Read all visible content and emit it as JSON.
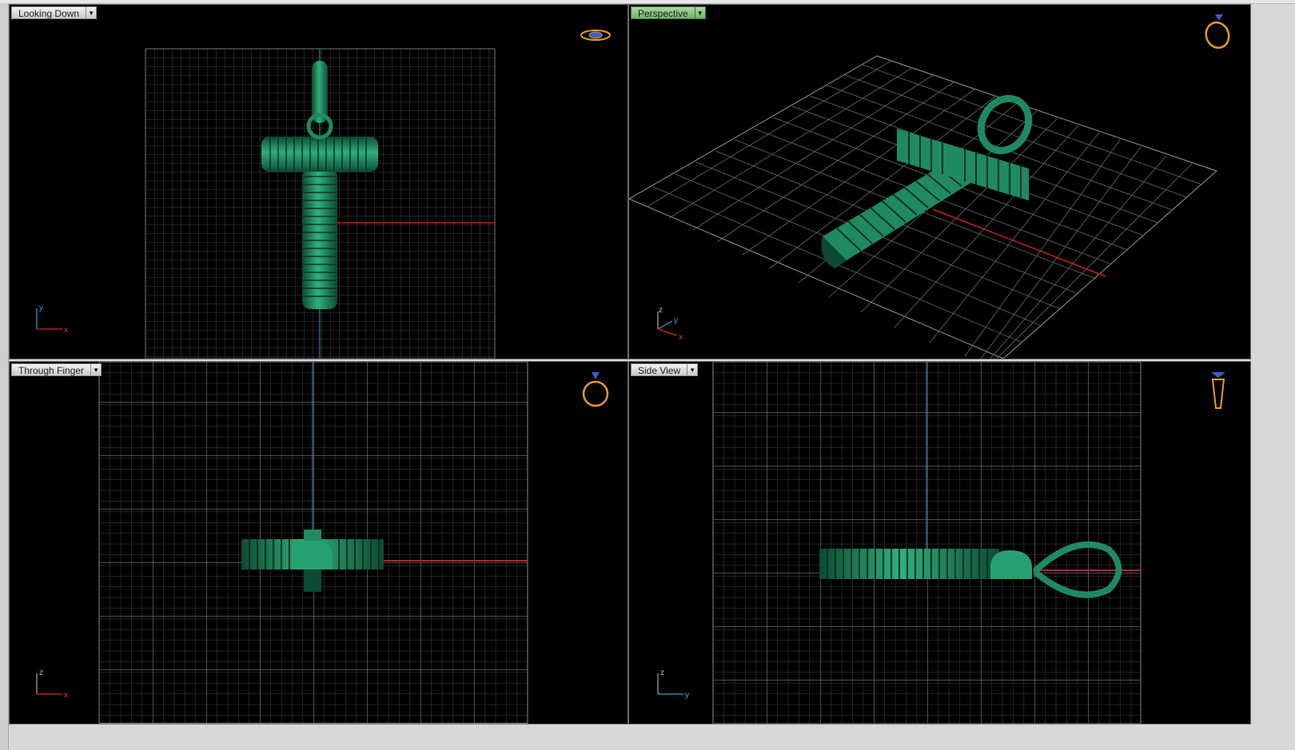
{
  "viewports": [
    {
      "label": "Looking Down",
      "active": false,
      "ring_icon": "ring-top-view-icon",
      "axes": [
        "y",
        "x"
      ]
    },
    {
      "label": "Perspective",
      "active": true,
      "ring_icon": "ring-perspective-icon",
      "axes": [
        "z",
        "y",
        "x"
      ]
    },
    {
      "label": "Through Finger",
      "active": false,
      "ring_icon": "ring-front-view-icon",
      "axes": [
        "z",
        "x"
      ]
    },
    {
      "label": "Side View",
      "active": false,
      "ring_icon": "ring-side-view-icon",
      "axes": [
        "z",
        "y"
      ]
    }
  ],
  "colors": {
    "background": "#000000",
    "grid": "#5a5a5a",
    "grid_major": "#8a8a8a",
    "model": "#1f8a62",
    "model_dark": "#0d4a33",
    "x_axis": "#c0201b",
    "y_axis": "#2a86a8",
    "active_tab": "#7fbf7a"
  },
  "model": "cross-pendant"
}
